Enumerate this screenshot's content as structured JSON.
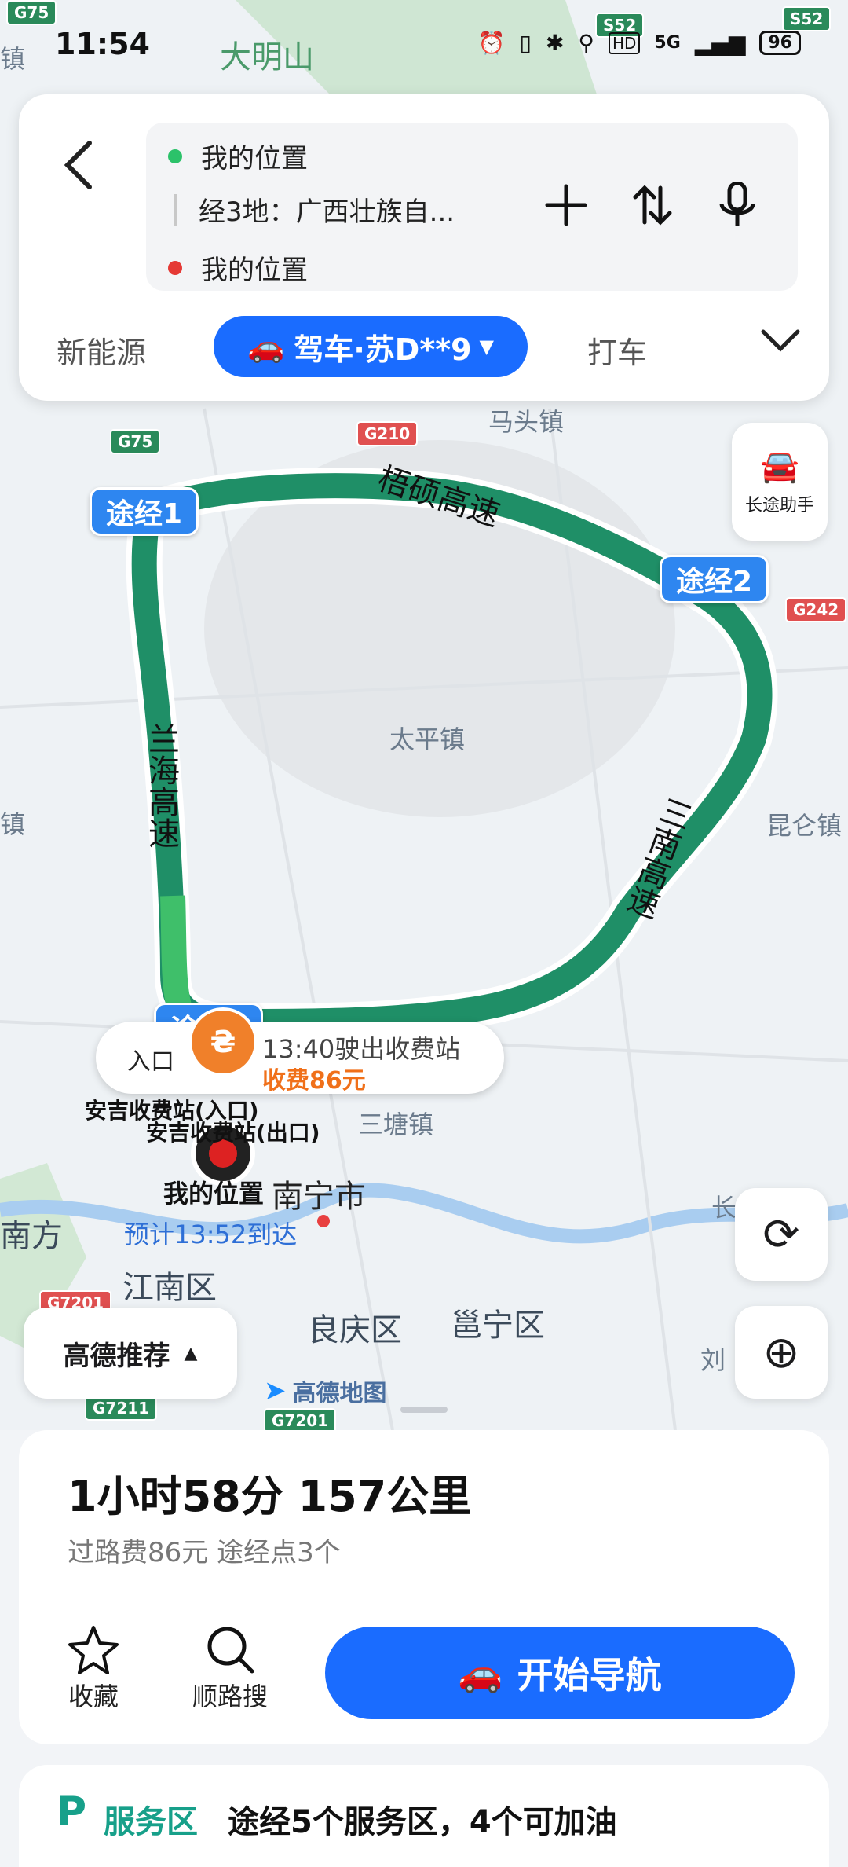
{
  "status_bar": {
    "time": "11:54",
    "battery": "96",
    "network": "5G"
  },
  "route_panel": {
    "origin": "我的位置",
    "via": "经3地：广西壮族自...",
    "destination": "我的位置",
    "modes": {
      "left": "新能源",
      "active": "驾车·苏D**9",
      "right": "打车"
    }
  },
  "map": {
    "labels": {
      "damingshan": "大明山",
      "matou": "马头镇",
      "taiping": "太平镇",
      "kunlun": "昆仑镇",
      "santang": "三塘镇",
      "nanning": "南宁市",
      "jiangnan": "江南区",
      "liangqing": "良庆区",
      "yongning": "邕宁区",
      "nanfang": "南方",
      "liu": "刘",
      "chang": "长",
      "edge_zhen": "镇",
      "edge_zhen2": "镇"
    },
    "roads": {
      "wushuo": "梧硕高速",
      "lanhai": "兰海高速",
      "sannan": "三南高速"
    },
    "shields": {
      "g75": "G75",
      "s52a": "S52",
      "s52b": "S52",
      "g210": "G210",
      "g242": "G242",
      "g7201a": "G7201",
      "g7211": "G7211",
      "g7201b": "G7201",
      "g75top": "G75"
    },
    "waypoints": {
      "wp1": "途经1",
      "wp2": "途经2",
      "wp3": "途经3"
    },
    "toll": {
      "entry_tag": "入口",
      "time_text": "13:40驶出收费站",
      "fee_text": "收费86元",
      "station_in": "安吉收费站(入口)",
      "station_out": "安吉收费站(出口)"
    },
    "my_location": "我的位置",
    "eta": "预计13:52到达",
    "brand": "高德地图",
    "long_trip": "长途助手"
  },
  "recommend_label": "高德推荐",
  "summary": {
    "duration_distance": "1小时58分  157公里",
    "details": "过路费86元   途经点3个"
  },
  "actions": {
    "favorite": "收藏",
    "search_along": "顺路搜",
    "start": "开始导航"
  },
  "service_area": {
    "label": "服务区",
    "text": "途经5个服务区，4个可加油"
  },
  "colors": {
    "accent": "#1a6cff",
    "route": "#1f8f67",
    "toll": "#f0802a",
    "service": "#17a08a"
  }
}
